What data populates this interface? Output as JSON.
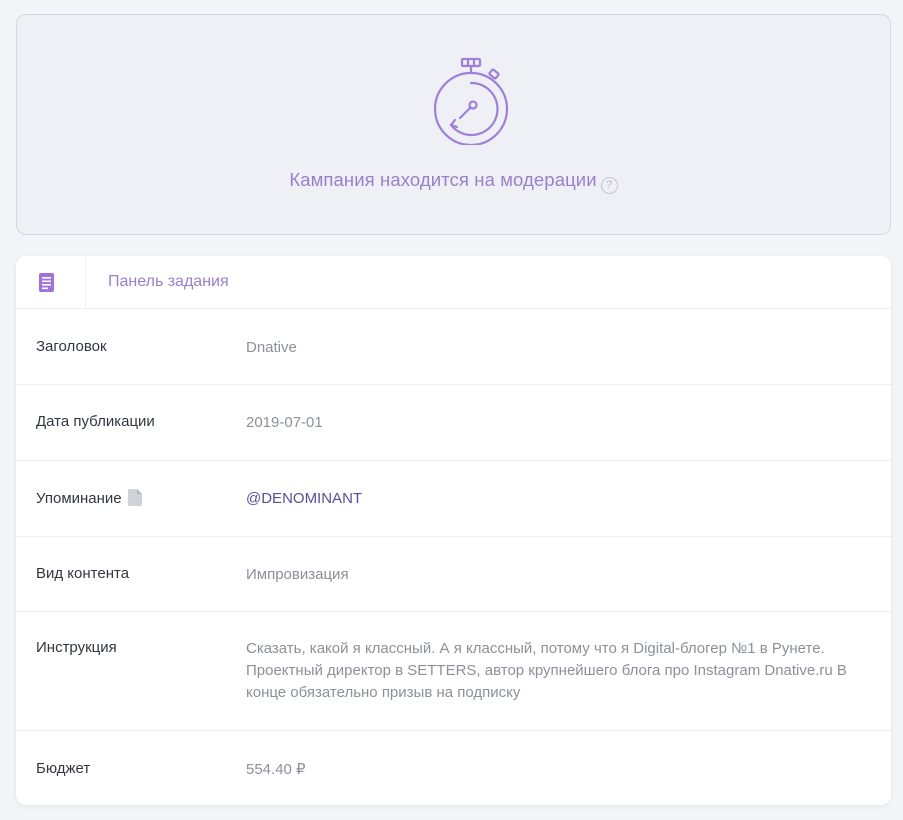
{
  "moderation": {
    "icon": "stopwatch-icon",
    "text": "Кампания находится на модерации",
    "help": "?",
    "accent_color": "#9a7fcb"
  },
  "panel": {
    "icon": "document-icon",
    "title": "Панель задания",
    "rows": [
      {
        "label": "Заголовок",
        "value": "Dnative"
      },
      {
        "label": "Дата публикации",
        "value": "2019-07-01"
      },
      {
        "label": "Упоминание",
        "value": "@DENOMINANT",
        "icon": "copy-icon"
      },
      {
        "label": "Вид контента",
        "value": "Импровизация"
      },
      {
        "label": "Инструкция",
        "value": "Сказать, какой я классный. А я классный, потому что я Digital-блогер №1 в Рунете. Проектный директор в SETTERS, автор крупнейшего блога про Instagram Dnative.ru В конце обязательно призыв на подписку"
      },
      {
        "label": "Бюджет",
        "value": "554.40 ₽"
      }
    ]
  }
}
